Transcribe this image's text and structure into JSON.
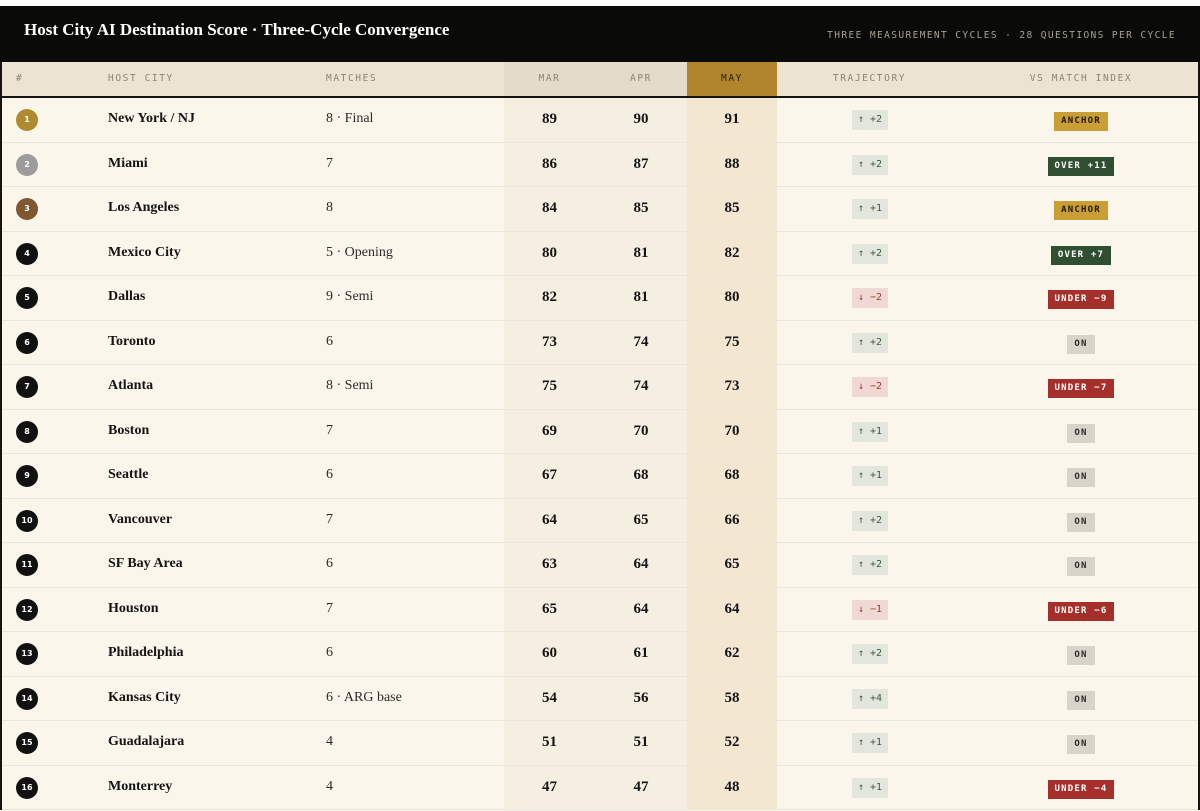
{
  "header": {
    "title": "Host City AI Destination Score · Three-Cycle Convergence",
    "subtitle": "THREE MEASUREMENT CYCLES · 28 QUESTIONS PER CYCLE"
  },
  "columns": {
    "rank": "#",
    "city": "HOST CITY",
    "matches": "MATCHES",
    "mar": "MAR",
    "apr": "APR",
    "may": "MAY",
    "trajectory": "TRAJECTORY",
    "vs_match_index": "VS MATCH INDEX"
  },
  "colors": {
    "header_bg": "#0a0a08",
    "may_highlight": "#b0842c",
    "anchor": "#c99f35",
    "over": "#2f4e32",
    "under": "#a5302b",
    "on": "#d8d4ca",
    "gold_rank": "#b08a2e",
    "silver_rank": "#9c9c9c",
    "bronze_rank": "#7f5733"
  },
  "rows": [
    {
      "rank": "1",
      "medal": "gold",
      "city": "New York / NJ",
      "matches": "8 · Final",
      "mar": "89",
      "apr": "90",
      "may": "91",
      "trajectory": "↑ +2",
      "direction": "up",
      "index": "ANCHOR",
      "index_type": "anchor"
    },
    {
      "rank": "2",
      "medal": "silver",
      "city": "Miami",
      "matches": "7",
      "mar": "86",
      "apr": "87",
      "may": "88",
      "trajectory": "↑ +2",
      "direction": "up",
      "index": "OVER +11",
      "index_type": "over"
    },
    {
      "rank": "3",
      "medal": "bronze",
      "city": "Los Angeles",
      "matches": "8",
      "mar": "84",
      "apr": "85",
      "may": "85",
      "trajectory": "↑ +1",
      "direction": "up",
      "index": "ANCHOR",
      "index_type": "anchor"
    },
    {
      "rank": "4",
      "medal": "",
      "city": "Mexico City",
      "matches": "5 · Opening",
      "mar": "80",
      "apr": "81",
      "may": "82",
      "trajectory": "↑ +2",
      "direction": "up",
      "index": "OVER +7",
      "index_type": "over"
    },
    {
      "rank": "5",
      "medal": "",
      "city": "Dallas",
      "matches": "9 · Semi",
      "mar": "82",
      "apr": "81",
      "may": "80",
      "trajectory": "↓ −2",
      "direction": "down",
      "index": "UNDER −9",
      "index_type": "under"
    },
    {
      "rank": "6",
      "medal": "",
      "city": "Toronto",
      "matches": "6",
      "mar": "73",
      "apr": "74",
      "may": "75",
      "trajectory": "↑ +2",
      "direction": "up",
      "index": "ON",
      "index_type": "on"
    },
    {
      "rank": "7",
      "medal": "",
      "city": "Atlanta",
      "matches": "8 · Semi",
      "mar": "75",
      "apr": "74",
      "may": "73",
      "trajectory": "↓ −2",
      "direction": "down",
      "index": "UNDER −7",
      "index_type": "under"
    },
    {
      "rank": "8",
      "medal": "",
      "city": "Boston",
      "matches": "7",
      "mar": "69",
      "apr": "70",
      "may": "70",
      "trajectory": "↑ +1",
      "direction": "up",
      "index": "ON",
      "index_type": "on"
    },
    {
      "rank": "9",
      "medal": "",
      "city": "Seattle",
      "matches": "6",
      "mar": "67",
      "apr": "68",
      "may": "68",
      "trajectory": "↑ +1",
      "direction": "up",
      "index": "ON",
      "index_type": "on"
    },
    {
      "rank": "10",
      "medal": "",
      "city": "Vancouver",
      "matches": "7",
      "mar": "64",
      "apr": "65",
      "may": "66",
      "trajectory": "↑ +2",
      "direction": "up",
      "index": "ON",
      "index_type": "on"
    },
    {
      "rank": "11",
      "medal": "",
      "city": "SF Bay Area",
      "matches": "6",
      "mar": "63",
      "apr": "64",
      "may": "65",
      "trajectory": "↑ +2",
      "direction": "up",
      "index": "ON",
      "index_type": "on"
    },
    {
      "rank": "12",
      "medal": "",
      "city": "Houston",
      "matches": "7",
      "mar": "65",
      "apr": "64",
      "may": "64",
      "trajectory": "↓ −1",
      "direction": "down",
      "index": "UNDER −6",
      "index_type": "under"
    },
    {
      "rank": "13",
      "medal": "",
      "city": "Philadelphia",
      "matches": "6",
      "mar": "60",
      "apr": "61",
      "may": "62",
      "trajectory": "↑ +2",
      "direction": "up",
      "index": "ON",
      "index_type": "on"
    },
    {
      "rank": "14",
      "medal": "",
      "city": "Kansas City",
      "matches": "6 · ARG base",
      "mar": "54",
      "apr": "56",
      "may": "58",
      "trajectory": "↑ +4",
      "direction": "up",
      "index": "ON",
      "index_type": "on"
    },
    {
      "rank": "15",
      "medal": "",
      "city": "Guadalajara",
      "matches": "4",
      "mar": "51",
      "apr": "51",
      "may": "52",
      "trajectory": "↑ +1",
      "direction": "up",
      "index": "ON",
      "index_type": "on"
    },
    {
      "rank": "16",
      "medal": "",
      "city": "Monterrey",
      "matches": "4",
      "mar": "47",
      "apr": "47",
      "may": "48",
      "trajectory": "↑ +1",
      "direction": "up",
      "index": "UNDER −4",
      "index_type": "under"
    }
  ]
}
